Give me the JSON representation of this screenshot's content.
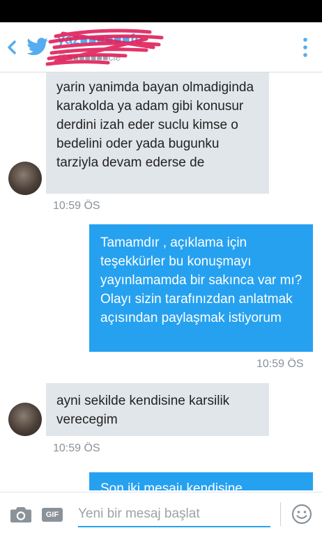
{
  "header": {
    "name": "yaz■■■■■■fe",
    "handle": "@■■■■■■■cle"
  },
  "messages": [
    {
      "direction": "in",
      "text": "yarin yanimda bayan olmadiginda karakolda ya adam gibi konusur derdini izah eder suclu kimse o bedelini oder yada bugunku tarziyla devam ederse de",
      "time": "10:59 ÖS"
    },
    {
      "direction": "out",
      "text": "Tamamdır , açıklama için teşekkürler bu konuşmayı yayınlamamda bir sakınca var mı? Olayı sizin tarafınızdan anlatmak açısından paylaşmak istiyorum",
      "time": "10:59 ÖS"
    },
    {
      "direction": "in",
      "text": "ayni sekilde kendisine karsilik verecegim",
      "time": "10:59 ÖS"
    },
    {
      "direction": "out",
      "text": "Son iki mesajı kendisine",
      "time": ""
    }
  ],
  "composer": {
    "placeholder": "Yeni bir mesaj başlat",
    "value": "",
    "gif_label": "GIF"
  },
  "colors": {
    "accent": "#55acee",
    "outgoing_bubble": "#26a1f0",
    "incoming_bubble": "#e1e6ea",
    "redaction": "#e0245e"
  }
}
